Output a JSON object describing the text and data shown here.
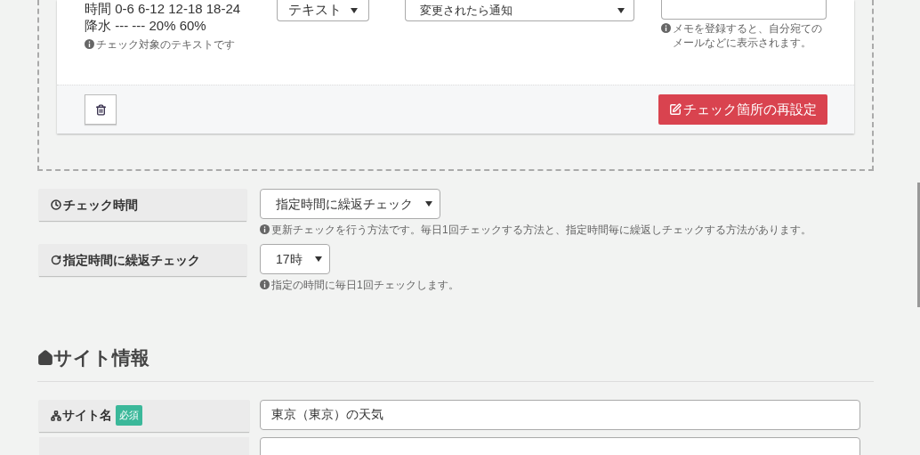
{
  "check_target": {
    "text_lines": [
      "時間 0-6 6-12 12-18 18-24",
      "降水 --- --- 20% 60%"
    ],
    "hint": "チェック対象のテキストです"
  },
  "type_select": {
    "value": "テキスト"
  },
  "notify_select": {
    "value": "変更されたら通知"
  },
  "memo": {
    "hint": "メモを登録すると、自分宛てのメールなどに表示されます。"
  },
  "card_footer": {
    "reset_button": "チェック箇所の再設定"
  },
  "check_settings": [
    {
      "kind": "clock",
      "label": "チェック時間",
      "value": "指定時間に繰返チェック",
      "hint": "更新チェックを行う方法です。毎日1回チェックする方法と、指定時間毎に繰返しチェックする方法があります。"
    },
    {
      "kind": "repeat",
      "label": "指定時間に繰返チェック",
      "value": "17時",
      "hint": "指定の時間に毎日1回チェックします。"
    }
  ],
  "site_info": {
    "title": "サイト情報",
    "fields": [
      {
        "label": "サイト名",
        "badge": "必須",
        "value": "東京（東京）の天気"
      }
    ]
  }
}
